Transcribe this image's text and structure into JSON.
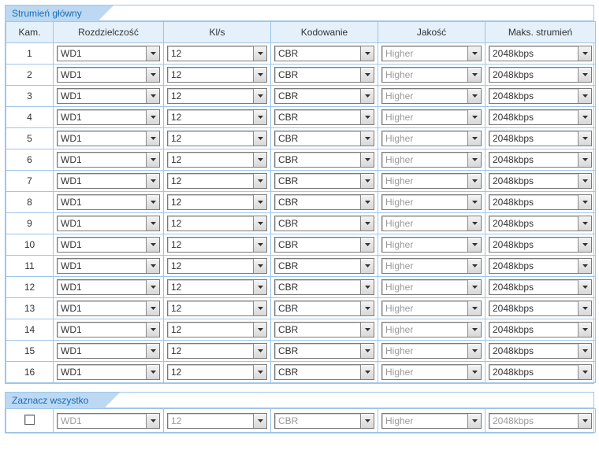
{
  "panel_main": {
    "title": "Strumień główny"
  },
  "panel_all": {
    "title": "Zaznacz wszystko"
  },
  "headers": {
    "camera": "Kam.",
    "resolution": "Rozdzielczość",
    "fps": "Kl/s",
    "encoding": "Kodowanie",
    "quality": "Jakość",
    "maxstream": "Maks. strumień"
  },
  "rows": [
    {
      "cam": "1",
      "resolution": "WD1",
      "fps": "12",
      "encoding": "CBR",
      "quality": "Higher",
      "maxstream": "2048kbps"
    },
    {
      "cam": "2",
      "resolution": "WD1",
      "fps": "12",
      "encoding": "CBR",
      "quality": "Higher",
      "maxstream": "2048kbps"
    },
    {
      "cam": "3",
      "resolution": "WD1",
      "fps": "12",
      "encoding": "CBR",
      "quality": "Higher",
      "maxstream": "2048kbps"
    },
    {
      "cam": "4",
      "resolution": "WD1",
      "fps": "12",
      "encoding": "CBR",
      "quality": "Higher",
      "maxstream": "2048kbps"
    },
    {
      "cam": "5",
      "resolution": "WD1",
      "fps": "12",
      "encoding": "CBR",
      "quality": "Higher",
      "maxstream": "2048kbps"
    },
    {
      "cam": "6",
      "resolution": "WD1",
      "fps": "12",
      "encoding": "CBR",
      "quality": "Higher",
      "maxstream": "2048kbps"
    },
    {
      "cam": "7",
      "resolution": "WD1",
      "fps": "12",
      "encoding": "CBR",
      "quality": "Higher",
      "maxstream": "2048kbps"
    },
    {
      "cam": "8",
      "resolution": "WD1",
      "fps": "12",
      "encoding": "CBR",
      "quality": "Higher",
      "maxstream": "2048kbps"
    },
    {
      "cam": "9",
      "resolution": "WD1",
      "fps": "12",
      "encoding": "CBR",
      "quality": "Higher",
      "maxstream": "2048kbps"
    },
    {
      "cam": "10",
      "resolution": "WD1",
      "fps": "12",
      "encoding": "CBR",
      "quality": "Higher",
      "maxstream": "2048kbps"
    },
    {
      "cam": "11",
      "resolution": "WD1",
      "fps": "12",
      "encoding": "CBR",
      "quality": "Higher",
      "maxstream": "2048kbps"
    },
    {
      "cam": "12",
      "resolution": "WD1",
      "fps": "12",
      "encoding": "CBR",
      "quality": "Higher",
      "maxstream": "2048kbps"
    },
    {
      "cam": "13",
      "resolution": "WD1",
      "fps": "12",
      "encoding": "CBR",
      "quality": "Higher",
      "maxstream": "2048kbps"
    },
    {
      "cam": "14",
      "resolution": "WD1",
      "fps": "12",
      "encoding": "CBR",
      "quality": "Higher",
      "maxstream": "2048kbps"
    },
    {
      "cam": "15",
      "resolution": "WD1",
      "fps": "12",
      "encoding": "CBR",
      "quality": "Higher",
      "maxstream": "2048kbps"
    },
    {
      "cam": "16",
      "resolution": "WD1",
      "fps": "12",
      "encoding": "CBR",
      "quality": "Higher",
      "maxstream": "2048kbps"
    }
  ],
  "all_row": {
    "checked": false,
    "resolution": "WD1",
    "fps": "12",
    "encoding": "CBR",
    "quality": "Higher",
    "maxstream": "2048kbps"
  }
}
